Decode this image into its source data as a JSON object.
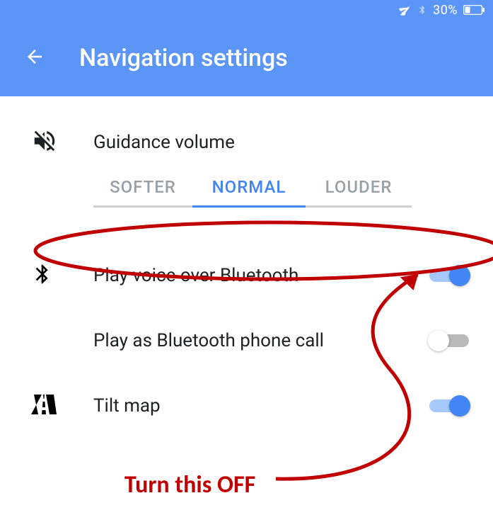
{
  "status": {
    "battery_pct": "30%"
  },
  "header": {
    "title": "Navigation settings"
  },
  "guidance": {
    "label": "Guidance volume",
    "tabs": {
      "softer": "SOFTER",
      "normal": "NORMAL",
      "louder": "LOUDER"
    }
  },
  "settings": {
    "play_bt": "Play voice over Bluetooth",
    "play_call": "Play as Bluetooth phone call",
    "tilt": "Tilt map"
  },
  "annotation": {
    "text": "Turn this OFF"
  }
}
